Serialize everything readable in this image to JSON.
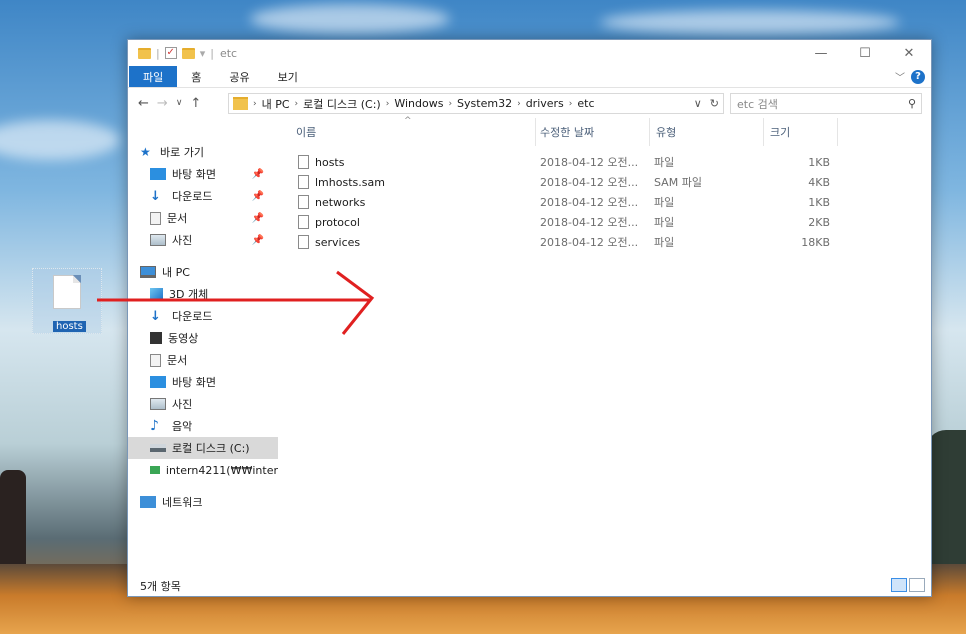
{
  "desktop": {
    "icon_label": "hosts"
  },
  "window": {
    "title": "etc",
    "controls": {
      "minimize": "—",
      "maximize": "☐",
      "close": "✕"
    }
  },
  "ribbon": {
    "tabs": [
      "파일",
      "홈",
      "공유",
      "보기"
    ],
    "help": "?"
  },
  "address": {
    "crumbs": [
      "내 PC",
      "로컬 디스크 (C:)",
      "Windows",
      "System32",
      "drivers",
      "etc"
    ],
    "search_placeholder": "etc 검색"
  },
  "columns": {
    "name": "이름",
    "date": "수정한 날짜",
    "type": "유형",
    "size": "크기"
  },
  "nav": {
    "quick_access": "바로 가기",
    "quick_items": [
      "바탕 화면",
      "다운로드",
      "문서",
      "사진"
    ],
    "this_pc": "내 PC",
    "pc_items": [
      "3D 개체",
      "다운로드",
      "동영상",
      "문서",
      "바탕 화면",
      "사진",
      "음악",
      "로컬 디스크 (C:)",
      "intern4211(₩₩inter"
    ],
    "network": "네트워크"
  },
  "files": [
    {
      "name": "hosts",
      "date": "2018-04-12 오전...",
      "type": "파일",
      "size": "1KB"
    },
    {
      "name": "lmhosts.sam",
      "date": "2018-04-12 오전...",
      "type": "SAM 파일",
      "size": "4KB"
    },
    {
      "name": "networks",
      "date": "2018-04-12 오전...",
      "type": "파일",
      "size": "1KB"
    },
    {
      "name": "protocol",
      "date": "2018-04-12 오전...",
      "type": "파일",
      "size": "2KB"
    },
    {
      "name": "services",
      "date": "2018-04-12 오전...",
      "type": "파일",
      "size": "18KB"
    }
  ],
  "status": {
    "item_count": "5개 항목"
  },
  "colors": {
    "accent": "#1d72c9",
    "annotation_arrow": "#e02020"
  }
}
